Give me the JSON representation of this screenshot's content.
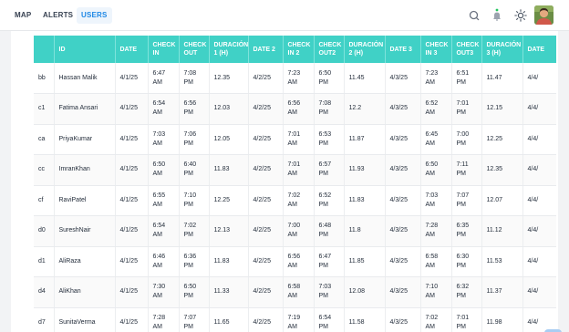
{
  "nav": {
    "tabs": [
      "MAP",
      "ALERTS",
      "USERS"
    ],
    "active": "USERS"
  },
  "table": {
    "headers": [
      "",
      "ID",
      "DATE",
      "CHECK IN",
      "CHECK OUT",
      "DURACIÓN 1 (H)",
      "DATE 2",
      "CHECK IN 2",
      "CHECK OUT2",
      "DURACIÓN 2 (H)",
      "DATE 3",
      "CHECK IN 3",
      "CHECK OUT3",
      "DURACIÓN 3 (H)",
      "DATE"
    ],
    "rows": [
      [
        "bb",
        "Hassan Malik",
        "4/1/25",
        "6:47 AM",
        "7:08 PM",
        "12.35",
        "4/2/25",
        "7:23 AM",
        "6:50 PM",
        "11.45",
        "4/3/25",
        "7:23 AM",
        "6:51 PM",
        "11.47",
        "4/4/"
      ],
      [
        "c1",
        "Fatima Ansari",
        "4/1/25",
        "6:54 AM",
        "6:56 PM",
        "12.03",
        "4/2/25",
        "6:56 AM",
        "7:08 PM",
        "12.2",
        "4/3/25",
        "6:52 AM",
        "7:01 PM",
        "12.15",
        "4/4/"
      ],
      [
        "ca",
        "PriyaKumar",
        "4/1/25",
        "7:03 AM",
        "7:06 PM",
        "12.05",
        "4/2/25",
        "7:01 AM",
        "6:53 PM",
        "11.87",
        "4/3/25",
        "6:45 AM",
        "7:00 PM",
        "12.25",
        "4/4/"
      ],
      [
        "cc",
        "ImranKhan",
        "4/1/25",
        "6:50 AM",
        "6:40 PM",
        "11.83",
        "4/2/25",
        "7:01 AM",
        "6:57 PM",
        "11.93",
        "4/3/25",
        "6:50 AM",
        "7:11 PM",
        "12.35",
        "4/4/"
      ],
      [
        "cf",
        "RaviPatel",
        "4/1/25",
        "6:55 AM",
        "7:10 PM",
        "12.25",
        "4/2/25",
        "7:02 AM",
        "6:52 PM",
        "11.83",
        "4/3/25",
        "7:03 AM",
        "7:07 PM",
        "12.07",
        "4/4/"
      ],
      [
        "d0",
        "SureshNair",
        "4/1/25",
        "6:54 AM",
        "7:02 PM",
        "12.13",
        "4/2/25",
        "7:00 AM",
        "6:48 PM",
        "11.8",
        "4/3/25",
        "7:28 AM",
        "6:35 PM",
        "11.12",
        "4/4/"
      ],
      [
        "d1",
        "AliRaza",
        "4/1/25",
        "6:46 AM",
        "6:36 PM",
        "11.83",
        "4/2/25",
        "6:56 AM",
        "6:47 PM",
        "11.85",
        "4/3/25",
        "6:58 AM",
        "6:30 PM",
        "11.53",
        "4/4/"
      ],
      [
        "d4",
        "AliKhan",
        "4/1/25",
        "7:30 AM",
        "6:50 PM",
        "11.33",
        "4/2/25",
        "6:58 AM",
        "7:03 PM",
        "12.08",
        "4/3/25",
        "7:10 AM",
        "6:32 PM",
        "11.37",
        "4/4/"
      ],
      [
        "d7",
        "SunitaVerma",
        "4/1/25",
        "7:28 AM",
        "7:07 PM",
        "11.65",
        "4/2/25",
        "7:19 AM",
        "6:54 PM",
        "11.58",
        "4/3/25",
        "7:02 AM",
        "7:01 PM",
        "11.98",
        "4/4/"
      ]
    ]
  },
  "icons": {
    "search": "search-icon",
    "notifications": "bell-icon",
    "theme": "sun-icon",
    "avatar": "user-avatar",
    "fab": "floating-action-button"
  },
  "colors": {
    "header_bg": "#40d1c6",
    "active_tab": "#1e88e5",
    "status_dot": "#22c55e",
    "fab": "#a9cdf3"
  }
}
